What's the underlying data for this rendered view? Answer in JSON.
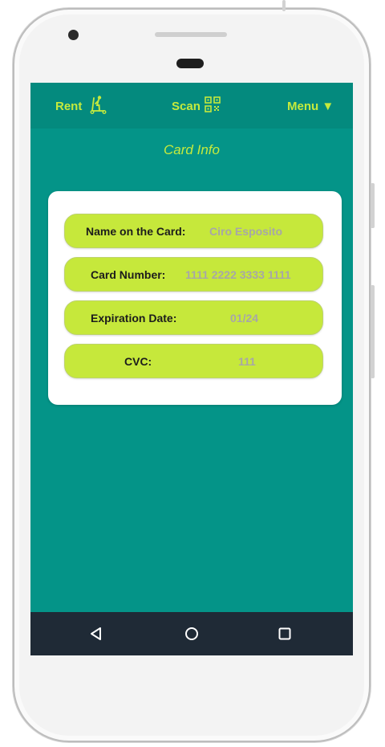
{
  "topbar": {
    "rent_label": "Rent",
    "scan_label": "Scan",
    "menu_label": "Menu ▼"
  },
  "page": {
    "title": "Card Info"
  },
  "card": {
    "fields": [
      {
        "label": "Name on the Card:",
        "value": "Ciro Esposito"
      },
      {
        "label": "Card Number:",
        "value": "1111 2222 3333 1111"
      },
      {
        "label": "Expiration Date:",
        "value": "01/24"
      },
      {
        "label": "CVC:",
        "value": "111"
      }
    ]
  },
  "icons": {
    "rent": "scooter-icon",
    "scan": "qr-code-icon",
    "back": "back-triangle-icon",
    "home": "home-circle-icon",
    "recent": "recent-apps-square-icon"
  },
  "colors": {
    "screen_bg": "#049488",
    "topbar_bg": "#048a7e",
    "accent": "#c5ea3d",
    "field_bg": "#c6e83b",
    "nav_bg": "#1f2a36"
  }
}
